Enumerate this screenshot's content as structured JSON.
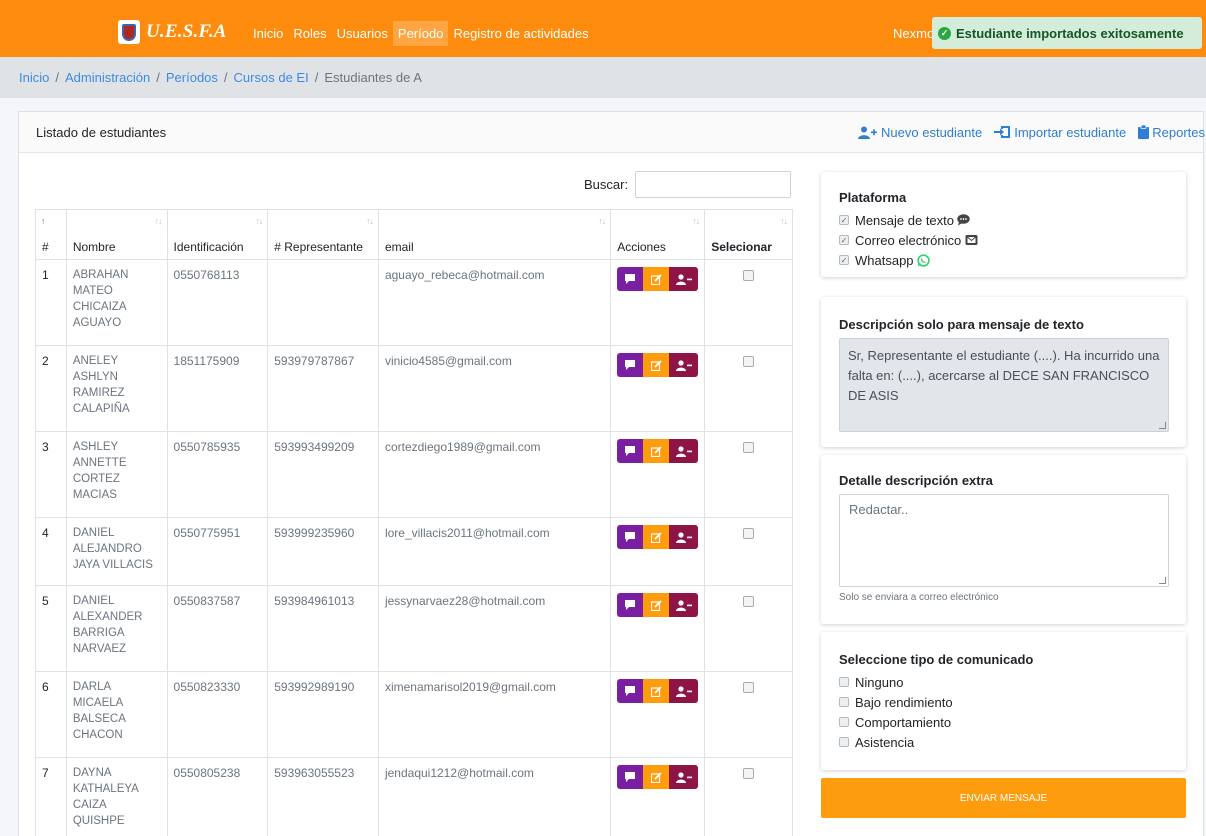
{
  "brand": {
    "name": "U.E.S.F.A"
  },
  "nav": {
    "items": [
      {
        "label": "Inicio"
      },
      {
        "label": "Roles"
      },
      {
        "label": "Usuarios"
      },
      {
        "label": "Período"
      },
      {
        "label": "Registro de actividades"
      }
    ],
    "user": "Nexmo"
  },
  "toast": {
    "message": "Estudiante importados exitosamente"
  },
  "breadcrumb": {
    "items": [
      "Inicio",
      "Administración",
      "Períodos",
      "Cursos de EI"
    ],
    "current": "Estudiantes de A"
  },
  "card": {
    "title": "Listado de estudiantes",
    "actions": {
      "new_student": "Nuevo estudiante",
      "import_student": "Importar estudiante",
      "reports": "Reportes"
    }
  },
  "search": {
    "label": "Buscar:"
  },
  "table": {
    "headers": {
      "num": "#",
      "name": "Nombre",
      "id": "Identificación",
      "rep": "# Representante",
      "email": "email",
      "actions": "Acciones",
      "select": "Selecionar"
    },
    "rows": [
      {
        "num": "1",
        "name": "ABRAHAN MATEO CHICAIZA AGUAYO",
        "id": "0550768113",
        "rep": "",
        "email": "aguayo_rebeca@hotmail.com"
      },
      {
        "num": "2",
        "name": "ANELEY ASHLYN RAMIREZ CALAPIÑA",
        "id": "1851175909",
        "rep": "593979787867",
        "email": "vinicio4585@gmail.com"
      },
      {
        "num": "3",
        "name": "ASHLEY ANNETTE CORTEZ MACIAS",
        "id": "0550785935",
        "rep": "593993499209",
        "email": "cortezdiego1989@gmail.com"
      },
      {
        "num": "4",
        "name": "DANIEL ALEJANDRO JAYA VILLACIS",
        "id": "0550775951",
        "rep": "593999235960",
        "email": "lore_villacis2011@hotmail.com"
      },
      {
        "num": "5",
        "name": "DANIEL ALEXANDER BARRIGA NARVAEZ",
        "id": "0550837587",
        "rep": "593984961013",
        "email": "jessynarvaez28@hotmail.com"
      },
      {
        "num": "6",
        "name": "DARLA MICAELA BALSECA CHACON",
        "id": "0550823330",
        "rep": "593992989190",
        "email": "ximenamarisol2019@gmail.com"
      },
      {
        "num": "7",
        "name": "DAYNA KATHALEYA CAIZA QUISHPE",
        "id": "0550805238",
        "rep": "593963055523",
        "email": "jendaqui1212@hotmail.com"
      }
    ]
  },
  "platform": {
    "title": "Plataforma",
    "options": [
      {
        "label": "Mensaje de texto",
        "icon": "chat-icon",
        "checked": true
      },
      {
        "label": "Correo electrónico",
        "icon": "mail-icon",
        "checked": true
      },
      {
        "label": "Whatsapp",
        "icon": "whatsapp-icon",
        "checked": true
      }
    ]
  },
  "sms_description": {
    "title": "Descripción solo para mensaje de texto",
    "text": "Sr, Representante el estudiante (....). Ha incurrido una falta en: (....), acercarse al DECE SAN FRANCISCO DE ASIS"
  },
  "extra_detail": {
    "title": "Detalle descripción extra",
    "placeholder": "Redactar..",
    "hint": "Solo se enviara a correo electrónico"
  },
  "comm_type": {
    "title": "Seleccione tipo de comunicado",
    "options": [
      "Ninguno",
      "Bajo rendimiento",
      "Comportamiento",
      "Asistencia"
    ]
  },
  "send_button": {
    "label": "ENVIAR MENSAJE"
  },
  "colors": {
    "primary": "#fd8c0e",
    "purple": "#7b1fa2",
    "maroon": "#8e1446",
    "link": "#2f7dd4"
  }
}
